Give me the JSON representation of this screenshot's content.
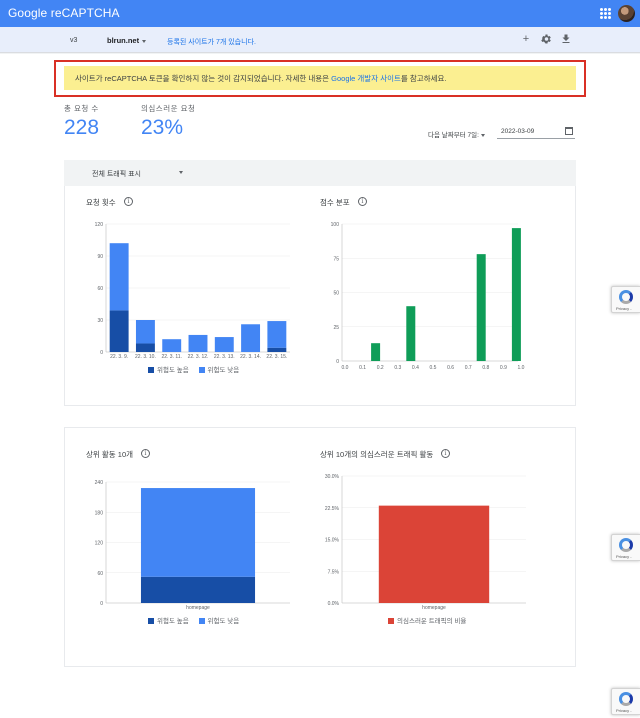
{
  "app": {
    "title": "Google reCAPTCHA"
  },
  "subbar": {
    "version": "v3",
    "site": "blrun.net",
    "registered": "등록된 사이트가 7개 있습니다."
  },
  "alert": {
    "text_before": "사이트가 reCAPTCHA 토큰을 확인하지 않는 것이 감지되었습니다. 자세한 내용은 ",
    "link": "Google 개발자 사이트",
    "text_after": "를 참고하세요."
  },
  "stats": [
    {
      "label": "총 요청 수",
      "value": "228"
    },
    {
      "label": "의심스러운 요청",
      "value": "23%"
    }
  ],
  "date": {
    "label": "다음 날짜부터 7일:",
    "value": "2022-03-09"
  },
  "filter": {
    "label": "전체 트래픽 표시"
  },
  "colors": {
    "high_risk": "#174ea6",
    "low_risk": "#4285f4",
    "score": "#0f9d58",
    "suspicious": "#db4437"
  },
  "icons": [
    "apps-grid-icon",
    "user-avatar",
    "add-icon",
    "settings-icon",
    "download-icon",
    "info-icon",
    "calendar-icon",
    "recaptcha-logo"
  ],
  "charts": {
    "requests": {
      "title": "요청 횟수"
    },
    "scores": {
      "title": "점수 분포"
    },
    "top10": {
      "title": "상위 활동 10개"
    },
    "suspicious": {
      "title": "상위 10개의 의심스러운 트래픽 활동"
    }
  },
  "recaptcha_badge": {
    "text": "Privacy -"
  },
  "chart_data": [
    {
      "type": "bar",
      "title": "요청 횟수",
      "categories": [
        "22. 3. 9.",
        "22. 3. 10.",
        "22. 3. 11.",
        "22. 3. 12.",
        "22. 3. 13.",
        "22. 3. 14.",
        "22. 3. 15."
      ],
      "series": [
        {
          "name": "위험도 높음",
          "values": [
            39,
            8,
            0,
            0,
            0,
            0,
            4
          ]
        },
        {
          "name": "위험도 낮음",
          "values": [
            63,
            22,
            12,
            16,
            14,
            26,
            25
          ]
        }
      ],
      "yticks": [
        "0",
        "30",
        "60",
        "90",
        "120"
      ],
      "ylim": [
        0,
        120
      ],
      "stacked": true,
      "legend": "bottom"
    },
    {
      "type": "bar",
      "title": "점수 분포",
      "categories": [
        "0.0",
        "0.1",
        "0.2",
        "0.3",
        "0.4",
        "0.5",
        "0.6",
        "0.7",
        "0.8",
        "0.9",
        "1.0"
      ],
      "values": [
        0,
        13,
        0,
        40,
        0,
        0,
        0,
        78,
        0,
        97,
        0
      ],
      "yticks": [
        "0",
        "25",
        "50",
        "75",
        "100"
      ],
      "ylim": [
        0,
        100
      ],
      "legend": "none"
    },
    {
      "type": "bar",
      "title": "상위 활동 10개",
      "categories": [
        "homepage"
      ],
      "series": [
        {
          "name": "위험도 높음",
          "values": [
            52
          ]
        },
        {
          "name": "위험도 낮음",
          "values": [
            176
          ]
        }
      ],
      "yticks": [
        "0",
        "60",
        "120",
        "180",
        "240"
      ],
      "ylim": [
        0,
        240
      ],
      "stacked": true,
      "legend": "bottom"
    },
    {
      "type": "bar",
      "title": "상위 10개의 의심스러운 트래픽 활동",
      "categories": [
        "homepage"
      ],
      "series": [
        {
          "name": "의심스러운 트래픽의 비율",
          "values": [
            23
          ]
        }
      ],
      "yticks": [
        "0.0%",
        "7.5%",
        "15.0%",
        "22.5%",
        "30.0%"
      ],
      "ylim": [
        0,
        30
      ],
      "legend": "bottom"
    }
  ]
}
